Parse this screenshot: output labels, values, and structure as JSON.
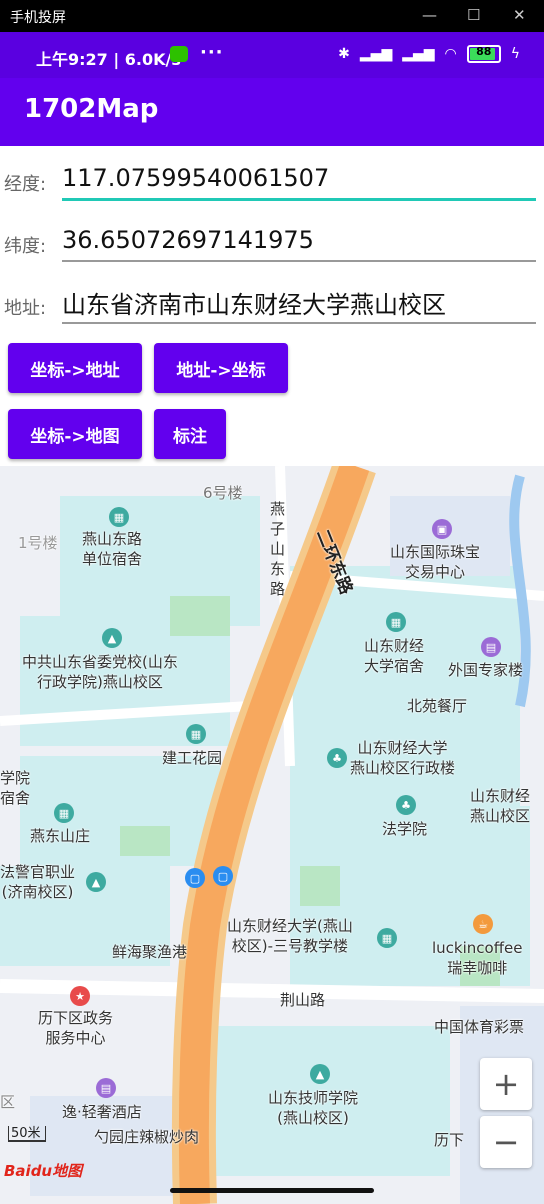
{
  "window": {
    "title": "手机投屏"
  },
  "status_bar": {
    "time": "上午9:27 | 6.0K/s",
    "dots": "···",
    "battery": "88"
  },
  "app": {
    "title": "1702Map"
  },
  "fields": {
    "longitude": {
      "label": "经度:",
      "value": "117.07599540061507"
    },
    "latitude": {
      "label": "纬度:",
      "value": "36.65072697141975"
    },
    "address": {
      "label": "地址:",
      "value": "山东省济南市山东财经大学燕山校区"
    }
  },
  "buttons": {
    "coord_to_address": "坐标->地址",
    "address_to_coord": "地址->坐标",
    "coord_to_map": "坐标->地图",
    "mark": "标注"
  },
  "map": {
    "labels": {
      "b6": "6号楼",
      "b1": "1号楼",
      "yanshan_road_dorm": "燕山东路\n单位宿舍",
      "yanzi": "燕\n子\n山\n东\n路",
      "ring_road": "二环东路",
      "jewelry": "山东国际珠宝\n交易中心",
      "party_school": "中共山东省委党校(山东\n行政学院)燕山校区",
      "sdufe_dorm": "山东财经\n大学宿舍",
      "foreign_expert": "外国专家楼",
      "beiyuan": "北苑餐厅",
      "jiangong": "建工花园",
      "admin_building": "山东财经大学\n燕山校区行政楼",
      "yuan_left": "学院\n宿舍",
      "sdufe_right": "山东财经\n燕山校区",
      "yandong": "燕东山庄",
      "law_school": "法学院",
      "police_school": "法警官职业\n(济南校区)",
      "teaching_3": "山东财经大学(燕山\n校区)-三号教学楼",
      "luckin": "luckincoffee\n瑞幸咖啡",
      "seafood": "鲜海聚渔港",
      "jingshan": "荆山路",
      "lixia_service": "历下区政务\n服务中心",
      "sports_lottery": "中国体育彩票",
      "tech_college": "山东技师学院\n(燕山校区)",
      "hotel": "逸·轻奢酒店",
      "spicy": "勺园庄辣椒炒肉",
      "lixia": "历下",
      "left_c": "区"
    },
    "scale": "50米",
    "logo": "Baidu地图",
    "zoom_in": "+",
    "zoom_out": "−"
  }
}
